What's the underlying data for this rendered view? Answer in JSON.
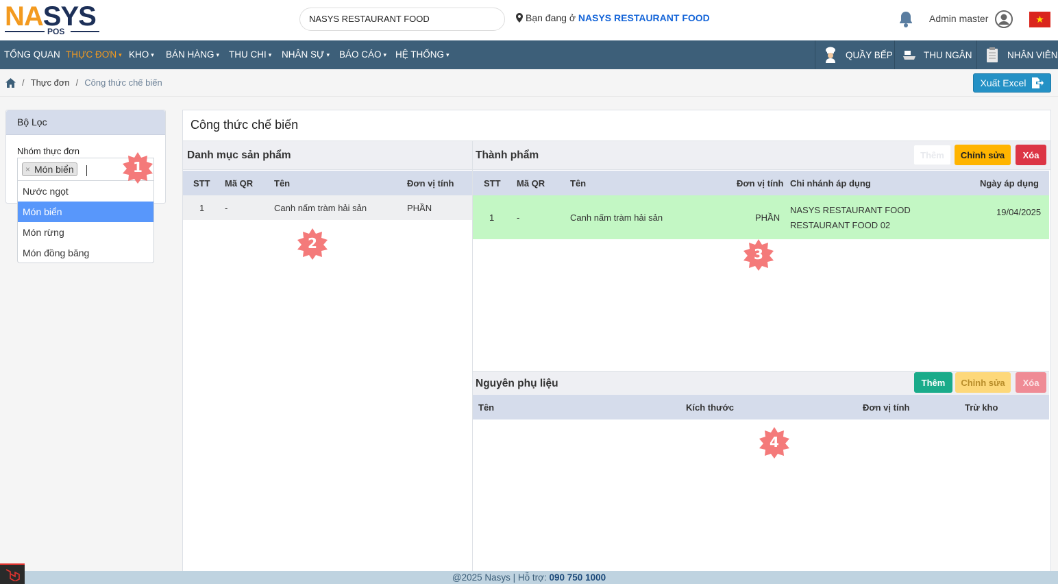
{
  "header": {
    "logo_text_1": "NA",
    "logo_text_2": "S",
    "logo_text_3": "YS",
    "logo_sub": "POS",
    "search_value": "NASYS RESTAURANT FOOD",
    "location_prefix": "Bạn đang ở",
    "location_name": "NASYS RESTAURANT FOOD",
    "admin_name": "Admin master",
    "flag_star": "★"
  },
  "nav": {
    "items": [
      {
        "label": "TỔNG QUAN"
      },
      {
        "label": "THỰC ĐƠN"
      },
      {
        "label": "KHO"
      },
      {
        "label": "BÁN HÀNG"
      },
      {
        "label": "THU CHI"
      },
      {
        "label": "NHÂN SỰ"
      },
      {
        "label": "BÁO CÁO"
      },
      {
        "label": "HỆ THỐNG"
      }
    ],
    "caret": "▾",
    "right": [
      {
        "label": "QUẦY BẾP",
        "icon": "chef-icon"
      },
      {
        "label": "THU NGÂN",
        "icon": "cashier-icon"
      },
      {
        "label": "NHÂN VIÊN",
        "icon": "clipboard-icon"
      }
    ]
  },
  "breadcrumb": {
    "sep": "/",
    "items": [
      "Thực đơn",
      "Công thức chế biến"
    ]
  },
  "toolbar": {
    "export_label": "Xuất Excel"
  },
  "filter": {
    "title": "Bộ Lọc",
    "group_label": "Nhóm thực đơn",
    "selected_tag": "Món biển",
    "remove_glyph": "×",
    "options": [
      "Nước ngọt",
      "Món biển",
      "Món rừng",
      "Món đồng băng"
    ],
    "highlighted_option": "Món biển"
  },
  "main": {
    "title": "Công thức chế biến",
    "products": {
      "title": "Danh mục sản phẩm",
      "columns": [
        "STT",
        "Mã QR",
        "Tên",
        "Đơn vị tính"
      ],
      "rows": [
        {
          "stt": "1",
          "qr": "-",
          "name": "Canh nấm tràm hải sản",
          "unit": "PHẦN"
        }
      ]
    },
    "finished": {
      "title": "Thành phẩm",
      "add_label": "Thêm",
      "edit_label": "Chỉnh sửa",
      "delete_label": "Xóa",
      "columns": [
        "STT",
        "Mã QR",
        "Tên",
        "Đơn vị tính",
        "Chi nhánh áp dụng",
        "Ngày áp dụng"
      ],
      "rows": [
        {
          "stt": "1",
          "qr": "-",
          "name": "Canh nấm tràm hải sản",
          "unit": "PHẦN",
          "branch_1": "NASYS RESTAURANT FOOD",
          "branch_2": "RESTAURANT FOOD 02",
          "date": "19/04/2025"
        }
      ]
    },
    "ingredients": {
      "title": "Nguyên phụ liệu",
      "add_label": "Thêm",
      "edit_label": "Chỉnh sửa",
      "delete_label": "Xóa",
      "columns": [
        "Tên",
        "Kích thước",
        "Đơn vị tính",
        "Trừ kho"
      ]
    }
  },
  "annotations": [
    "1",
    "2",
    "3",
    "4"
  ],
  "footer": {
    "text": "@2025 Nasys | Hỗ trợ:",
    "phone": "090 750 1000"
  },
  "colors": {
    "nav_bg": "#3d5f79",
    "accent_orange": "#f39a1f",
    "highlight_row": "#c3f7c4",
    "select_blue": "#5897fb",
    "badge_red": "#f36b6b"
  }
}
